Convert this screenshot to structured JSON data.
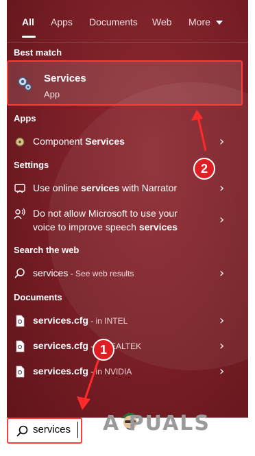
{
  "tabs": [
    "All",
    "Apps",
    "Documents",
    "Web",
    "More"
  ],
  "sections": {
    "best_match": "Best match",
    "apps": "Apps",
    "settings": "Settings",
    "search_web": "Search the web",
    "documents": "Documents"
  },
  "best_match": {
    "title": "Services",
    "subtitle": "App",
    "icon": "services-gear-icon"
  },
  "apps": [
    {
      "pre": "Component ",
      "bold": "Services",
      "icon": "component-services-icon"
    }
  ],
  "settings": [
    {
      "line1_pre": "Use online ",
      "line1_bold": "services",
      "line1_post": " with Narrator",
      "icon": "narrator-icon"
    },
    {
      "line1": "Do not allow Microsoft to use your",
      "line2_pre": "voice to improve speech ",
      "line2_bold": "services",
      "icon": "speech-icon"
    }
  ],
  "web": [
    {
      "text": "services",
      "sub": " - See web results",
      "icon": "search-icon"
    }
  ],
  "documents": [
    {
      "name": "services.cfg",
      "sub": " - in INTEL",
      "icon": "document-icon"
    },
    {
      "name": "services.cfg",
      "sub": " - in REALTEK",
      "icon": "document-icon"
    },
    {
      "name": "services.cfg",
      "sub": " - in NVIDIA",
      "icon": "document-icon"
    }
  ],
  "search": {
    "value": "services"
  },
  "annotations": {
    "badge1": "1",
    "badge2": "2"
  },
  "watermark": "A PUALS",
  "colors": {
    "panel": "#7a1f27",
    "highlight": "#ff3b3b",
    "badge": "#e01f25"
  }
}
